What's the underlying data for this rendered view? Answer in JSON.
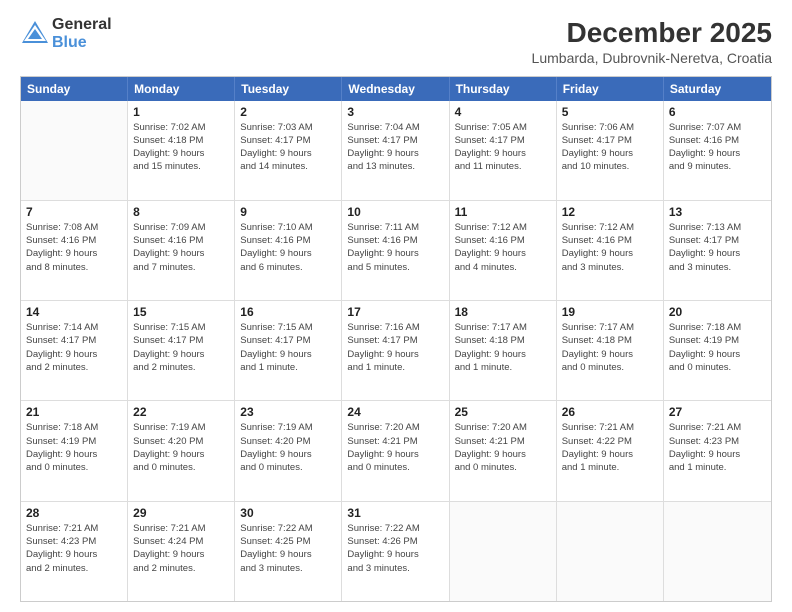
{
  "logo": {
    "general": "General",
    "blue": "Blue"
  },
  "header": {
    "title": "December 2025",
    "subtitle": "Lumbarda, Dubrovnik-Neretva, Croatia"
  },
  "weekdays": [
    "Sunday",
    "Monday",
    "Tuesday",
    "Wednesday",
    "Thursday",
    "Friday",
    "Saturday"
  ],
  "weeks": [
    [
      {
        "day": "",
        "info": ""
      },
      {
        "day": "1",
        "info": "Sunrise: 7:02 AM\nSunset: 4:18 PM\nDaylight: 9 hours\nand 15 minutes."
      },
      {
        "day": "2",
        "info": "Sunrise: 7:03 AM\nSunset: 4:17 PM\nDaylight: 9 hours\nand 14 minutes."
      },
      {
        "day": "3",
        "info": "Sunrise: 7:04 AM\nSunset: 4:17 PM\nDaylight: 9 hours\nand 13 minutes."
      },
      {
        "day": "4",
        "info": "Sunrise: 7:05 AM\nSunset: 4:17 PM\nDaylight: 9 hours\nand 11 minutes."
      },
      {
        "day": "5",
        "info": "Sunrise: 7:06 AM\nSunset: 4:17 PM\nDaylight: 9 hours\nand 10 minutes."
      },
      {
        "day": "6",
        "info": "Sunrise: 7:07 AM\nSunset: 4:16 PM\nDaylight: 9 hours\nand 9 minutes."
      }
    ],
    [
      {
        "day": "7",
        "info": "Sunrise: 7:08 AM\nSunset: 4:16 PM\nDaylight: 9 hours\nand 8 minutes."
      },
      {
        "day": "8",
        "info": "Sunrise: 7:09 AM\nSunset: 4:16 PM\nDaylight: 9 hours\nand 7 minutes."
      },
      {
        "day": "9",
        "info": "Sunrise: 7:10 AM\nSunset: 4:16 PM\nDaylight: 9 hours\nand 6 minutes."
      },
      {
        "day": "10",
        "info": "Sunrise: 7:11 AM\nSunset: 4:16 PM\nDaylight: 9 hours\nand 5 minutes."
      },
      {
        "day": "11",
        "info": "Sunrise: 7:12 AM\nSunset: 4:16 PM\nDaylight: 9 hours\nand 4 minutes."
      },
      {
        "day": "12",
        "info": "Sunrise: 7:12 AM\nSunset: 4:16 PM\nDaylight: 9 hours\nand 3 minutes."
      },
      {
        "day": "13",
        "info": "Sunrise: 7:13 AM\nSunset: 4:17 PM\nDaylight: 9 hours\nand 3 minutes."
      }
    ],
    [
      {
        "day": "14",
        "info": "Sunrise: 7:14 AM\nSunset: 4:17 PM\nDaylight: 9 hours\nand 2 minutes."
      },
      {
        "day": "15",
        "info": "Sunrise: 7:15 AM\nSunset: 4:17 PM\nDaylight: 9 hours\nand 2 minutes."
      },
      {
        "day": "16",
        "info": "Sunrise: 7:15 AM\nSunset: 4:17 PM\nDaylight: 9 hours\nand 1 minute."
      },
      {
        "day": "17",
        "info": "Sunrise: 7:16 AM\nSunset: 4:17 PM\nDaylight: 9 hours\nand 1 minute."
      },
      {
        "day": "18",
        "info": "Sunrise: 7:17 AM\nSunset: 4:18 PM\nDaylight: 9 hours\nand 1 minute."
      },
      {
        "day": "19",
        "info": "Sunrise: 7:17 AM\nSunset: 4:18 PM\nDaylight: 9 hours\nand 0 minutes."
      },
      {
        "day": "20",
        "info": "Sunrise: 7:18 AM\nSunset: 4:19 PM\nDaylight: 9 hours\nand 0 minutes."
      }
    ],
    [
      {
        "day": "21",
        "info": "Sunrise: 7:18 AM\nSunset: 4:19 PM\nDaylight: 9 hours\nand 0 minutes."
      },
      {
        "day": "22",
        "info": "Sunrise: 7:19 AM\nSunset: 4:20 PM\nDaylight: 9 hours\nand 0 minutes."
      },
      {
        "day": "23",
        "info": "Sunrise: 7:19 AM\nSunset: 4:20 PM\nDaylight: 9 hours\nand 0 minutes."
      },
      {
        "day": "24",
        "info": "Sunrise: 7:20 AM\nSunset: 4:21 PM\nDaylight: 9 hours\nand 0 minutes."
      },
      {
        "day": "25",
        "info": "Sunrise: 7:20 AM\nSunset: 4:21 PM\nDaylight: 9 hours\nand 0 minutes."
      },
      {
        "day": "26",
        "info": "Sunrise: 7:21 AM\nSunset: 4:22 PM\nDaylight: 9 hours\nand 1 minute."
      },
      {
        "day": "27",
        "info": "Sunrise: 7:21 AM\nSunset: 4:23 PM\nDaylight: 9 hours\nand 1 minute."
      }
    ],
    [
      {
        "day": "28",
        "info": "Sunrise: 7:21 AM\nSunset: 4:23 PM\nDaylight: 9 hours\nand 2 minutes."
      },
      {
        "day": "29",
        "info": "Sunrise: 7:21 AM\nSunset: 4:24 PM\nDaylight: 9 hours\nand 2 minutes."
      },
      {
        "day": "30",
        "info": "Sunrise: 7:22 AM\nSunset: 4:25 PM\nDaylight: 9 hours\nand 3 minutes."
      },
      {
        "day": "31",
        "info": "Sunrise: 7:22 AM\nSunset: 4:26 PM\nDaylight: 9 hours\nand 3 minutes."
      },
      {
        "day": "",
        "info": ""
      },
      {
        "day": "",
        "info": ""
      },
      {
        "day": "",
        "info": ""
      }
    ]
  ]
}
